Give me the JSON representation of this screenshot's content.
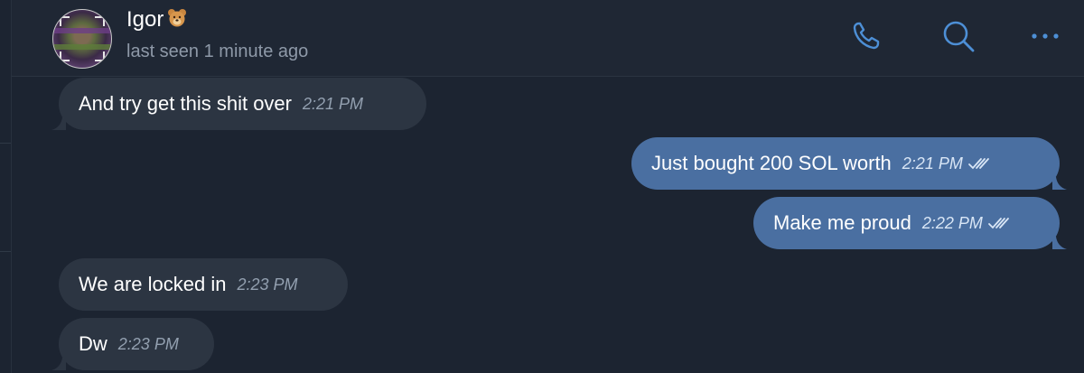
{
  "chat": {
    "contact_name": "Igor",
    "status": "last seen 1 minute ago",
    "name_emoji_icon": "bear-face-emoji",
    "colors": {
      "background": "#1c2431",
      "header": "#1f2734",
      "incoming_bubble": "#2c3542",
      "outgoing_bubble": "#4a6fa1",
      "accent_icon": "#4d8fd6"
    }
  },
  "header_actions": [
    {
      "icon": "phone-icon"
    },
    {
      "icon": "search-icon"
    },
    {
      "icon": "more-icon"
    }
  ],
  "messages": [
    {
      "direction": "incoming",
      "text": "And try get this shit over",
      "time": "2:21 PM",
      "read": false
    },
    {
      "direction": "outgoing",
      "text": "Just bought 200 SOL worth",
      "time": "2:21 PM",
      "read": true
    },
    {
      "direction": "outgoing",
      "text": "Make me proud",
      "time": "2:22 PM",
      "read": true
    },
    {
      "direction": "incoming",
      "text": "We are locked in",
      "time": "2:23 PM",
      "read": false
    },
    {
      "direction": "incoming",
      "text": "Dw",
      "time": "2:23 PM",
      "read": false
    }
  ]
}
